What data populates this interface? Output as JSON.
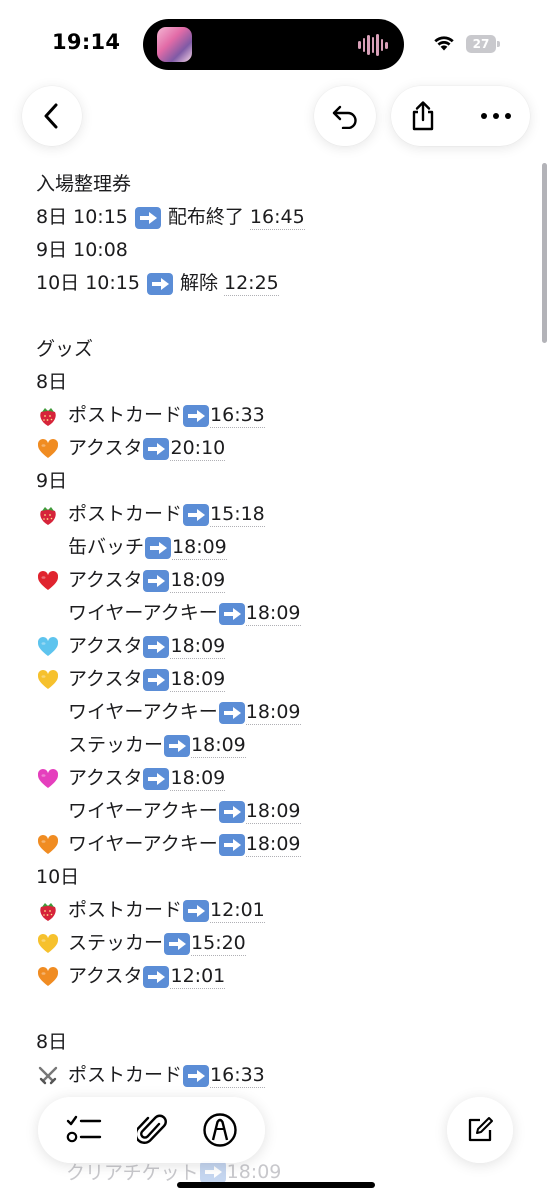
{
  "status_bar": {
    "time": "19:14",
    "battery": "27"
  },
  "note": {
    "lines": [
      {
        "type": "text",
        "text": "入場整理券"
      },
      {
        "type": "entry",
        "prefix": "8日 10:15",
        "arrow": true,
        "suffix": "配布終了",
        "time": "16:45"
      },
      {
        "type": "text",
        "text": "9日 10:08"
      },
      {
        "type": "entry",
        "prefix": "10日 10:15",
        "arrow": true,
        "suffix": "解除",
        "time": "12:25"
      },
      {
        "type": "blank"
      },
      {
        "type": "text",
        "text": "グッズ"
      },
      {
        "type": "text",
        "text": "8日"
      },
      {
        "type": "item",
        "emoji": "strawberry",
        "label": "ポストカード",
        "time": "16:33"
      },
      {
        "type": "item",
        "emoji": "orange-heart",
        "label": "アクスタ",
        "time": "20:10"
      },
      {
        "type": "text",
        "text": "9日"
      },
      {
        "type": "item",
        "emoji": "strawberry",
        "label": "ポストカード",
        "time": "15:18"
      },
      {
        "type": "item",
        "emoji": "none",
        "indent": true,
        "label": "缶バッチ",
        "time": "18:09"
      },
      {
        "type": "item",
        "emoji": "red-heart",
        "label": "アクスタ",
        "time": "18:09"
      },
      {
        "type": "item",
        "emoji": "none",
        "indent": true,
        "label": "ワイヤーアクキー",
        "time": "18:09"
      },
      {
        "type": "item",
        "emoji": "blue-heart",
        "label": "アクスタ",
        "time": "18:09"
      },
      {
        "type": "item",
        "emoji": "yellow-heart",
        "label": "アクスタ",
        "time": "18:09"
      },
      {
        "type": "item",
        "emoji": "none",
        "indent": true,
        "label": "ワイヤーアクキー",
        "time": "18:09"
      },
      {
        "type": "item",
        "emoji": "none",
        "indent": true,
        "label": "ステッカー",
        "time": "18:09"
      },
      {
        "type": "item",
        "emoji": "pink-heart",
        "label": "アクスタ",
        "time": "18:09"
      },
      {
        "type": "item",
        "emoji": "none",
        "indent": true,
        "label": "ワイヤーアクキー",
        "time": "18:09"
      },
      {
        "type": "item",
        "emoji": "orange-heart",
        "label": "ワイヤーアクキー",
        "time": "18:09"
      },
      {
        "type": "text",
        "text": "10日"
      },
      {
        "type": "item",
        "emoji": "strawberry",
        "label": "ポストカード",
        "time": "12:01"
      },
      {
        "type": "item",
        "emoji": "yellow-heart",
        "label": "ステッカー",
        "time": "15:20"
      },
      {
        "type": "item",
        "emoji": "orange-heart",
        "label": "アクスタ",
        "time": "12:01"
      },
      {
        "type": "blank"
      },
      {
        "type": "text",
        "text": "8日"
      },
      {
        "type": "item",
        "emoji": "crossed-swords",
        "label": "ポストカード",
        "time": "16:33"
      }
    ],
    "faded_line": {
      "label": "クリアチケット",
      "time": "18:09"
    }
  },
  "icons": {
    "back": "chevron-left-icon",
    "undo": "undo-icon",
    "share": "share-icon",
    "more": "ellipsis-icon",
    "checklist": "checklist-icon",
    "attachment": "paperclip-icon",
    "markup": "pen-markup-icon",
    "compose": "compose-icon"
  },
  "colors": {
    "arrow_box": "#5b8dd6",
    "strawberry": "#d6243a",
    "orange-heart": "#f08c22",
    "red-heart": "#e0242f",
    "blue-heart": "#5ec4ee",
    "yellow-heart": "#f6c12d",
    "pink-heart": "#e53fbd"
  }
}
